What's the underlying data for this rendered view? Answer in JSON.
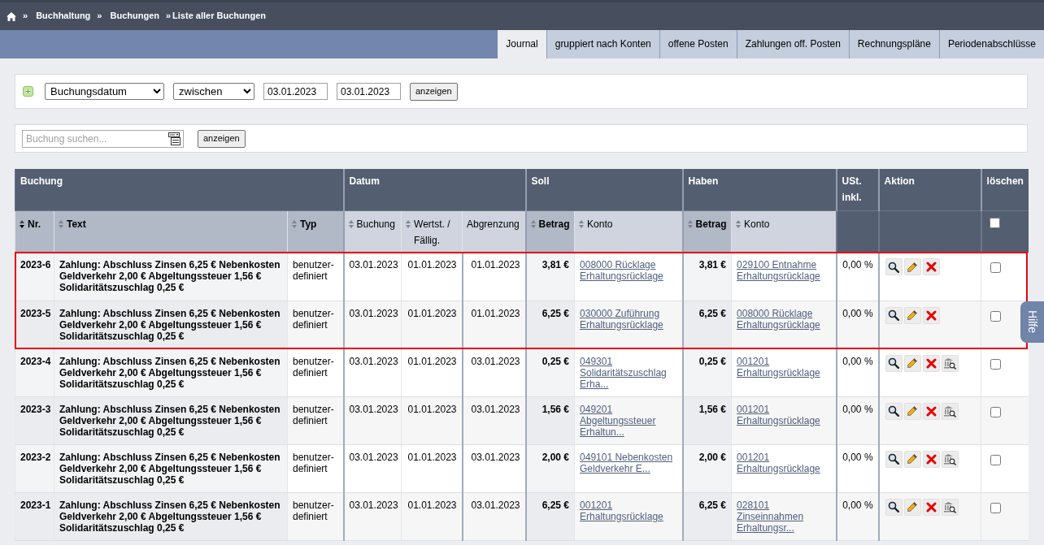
{
  "breadcrumb": {
    "items": [
      {
        "separator": "»",
        "label": "Buchhaltung"
      },
      {
        "separator": "»",
        "label": "Buchungen"
      },
      {
        "separator": "»",
        "label": "Liste aller Buchungen"
      }
    ]
  },
  "tabs": [
    {
      "label": "Journal",
      "selected": true
    },
    {
      "label": "gruppiert nach Konten",
      "selected": false
    },
    {
      "label": "offene Posten",
      "selected": false
    },
    {
      "label": "Zahlungen off. Posten",
      "selected": false
    },
    {
      "label": "Rechnungspläne",
      "selected": false
    },
    {
      "label": "Periodenabschlüsse",
      "selected": false
    }
  ],
  "filter": {
    "field": {
      "value": "Buchungsdatum"
    },
    "operator": {
      "value": "zwischen"
    },
    "from": {
      "value": "03.01.2023"
    },
    "to": {
      "value": "03.01.2023"
    },
    "button": "anzeigen"
  },
  "search": {
    "placeholder": "Buchung suchen...",
    "button": "anzeigen"
  },
  "table": {
    "groups": [
      {
        "label": "Buchung",
        "columns": [
          {
            "label": "Nr.",
            "kind": "key",
            "sortable": true,
            "sorted": true
          },
          {
            "label": "Text",
            "kind": "key",
            "sortable": true,
            "sorted": false
          },
          {
            "label": "Typ",
            "kind": "label",
            "sortable": true,
            "sorted": false
          }
        ]
      },
      {
        "label": "Datum",
        "columns": [
          {
            "label": "Buchung",
            "kind": "plain",
            "sortable": true,
            "sorted": false
          },
          {
            "label": "Wertst. / Fällig.",
            "kind": "plain",
            "sortable": true,
            "sorted": false
          },
          {
            "label": "Abgrenzung",
            "kind": "plain",
            "sortable": false
          }
        ]
      },
      {
        "label": "Soll",
        "columns": [
          {
            "label": "Betrag",
            "kind": "key",
            "sortable": true,
            "sorted": false
          },
          {
            "label": "Konto",
            "kind": "link",
            "sortable": true,
            "sorted": false
          }
        ]
      },
      {
        "label": "Haben",
        "columns": [
          {
            "label": "Betrag",
            "kind": "key",
            "sortable": true,
            "sorted": false
          },
          {
            "label": "Konto",
            "kind": "link",
            "sortable": true,
            "sorted": false
          }
        ]
      },
      {
        "label": "USt. inkl."
      },
      {
        "label": "Aktion"
      },
      {
        "label": "löschen",
        "select_all": {
          "checked": false
        }
      }
    ],
    "rows": [
      {
        "nr": "2023-6",
        "text": "Zahlung: Abschluss Zinsen 6,25 € Nebenkosten Geldverkehr 2,00 € Abgeltungssteuer 1,56 € Solidaritätszuschlag 0,25 €",
        "typ": "benutzer-definiert",
        "buchung": "03.01.2023",
        "wertstellung": "01.01.2023",
        "abgrenzung": "01.01.2023",
        "soll_betrag": "3,81 €",
        "soll_konto": "008000 Rücklage Erhaltungsrücklage",
        "haben_betrag": "3,81 €",
        "haben_konto": "029100 Entnahme Erhaltungsrücklage",
        "ust": "0,00 %",
        "actions": [
          {
            "kind": "view"
          },
          {
            "kind": "edit"
          },
          {
            "kind": "delete"
          }
        ],
        "checked": false,
        "highlighted": true
      },
      {
        "nr": "2023-5",
        "text": "Zahlung: Abschluss Zinsen 6,25 € Nebenkosten Geldverkehr 2,00 € Abgeltungssteuer 1,56 € Solidaritätszuschlag 0,25 €",
        "typ": "benutzer-definiert",
        "buchung": "03.01.2023",
        "wertstellung": "01.01.2023",
        "abgrenzung": "01.01.2023",
        "soll_betrag": "6,25 €",
        "soll_konto": "030000 Zuführung Erhaltungsrücklage",
        "haben_betrag": "6,25 €",
        "haben_konto": "008000 Rücklage Erhaltungsrücklage",
        "ust": "0,00 %",
        "actions": [
          {
            "kind": "view"
          },
          {
            "kind": "edit"
          },
          {
            "kind": "delete"
          }
        ],
        "checked": false,
        "highlighted": true
      },
      {
        "nr": "2023-4",
        "text": "Zahlung: Abschluss Zinsen 6,25 € Nebenkosten Geldverkehr 2,00 € Abgeltungssteuer 1,56 € Solidaritätszuschlag 0,25 €",
        "typ": "benutzer-definiert",
        "buchung": "03.01.2023",
        "wertstellung": "01.01.2023",
        "abgrenzung": "03.01.2023",
        "soll_betrag": "0,25 €",
        "soll_konto": "049301 Solidaritätszuschlag Erha...",
        "haben_betrag": "0,25 €",
        "haben_konto": "001201 Erhaltungsrücklage",
        "ust": "0,00 %",
        "actions": [
          {
            "kind": "view"
          },
          {
            "kind": "edit"
          },
          {
            "kind": "delete"
          },
          {
            "kind": "bank_search"
          }
        ],
        "checked": false,
        "highlighted": false
      },
      {
        "nr": "2023-3",
        "text": "Zahlung: Abschluss Zinsen 6,25 € Nebenkosten Geldverkehr 2,00 € Abgeltungssteuer 1,56 € Solidaritätszuschlag 0,25 €",
        "typ": "benutzer-definiert",
        "buchung": "03.01.2023",
        "wertstellung": "01.01.2023",
        "abgrenzung": "03.01.2023",
        "soll_betrag": "1,56 €",
        "soll_konto": "049201 Abgeltungssteuer Erhaltun...",
        "haben_betrag": "1,56 €",
        "haben_konto": "001201 Erhaltungsrücklage",
        "ust": "0,00 %",
        "actions": [
          {
            "kind": "view"
          },
          {
            "kind": "edit"
          },
          {
            "kind": "delete"
          },
          {
            "kind": "bank_search"
          }
        ],
        "checked": false,
        "highlighted": false
      },
      {
        "nr": "2023-2",
        "text": "Zahlung: Abschluss Zinsen 6,25 € Nebenkosten Geldverkehr 2,00 € Abgeltungssteuer 1,56 € Solidaritätszuschlag 0,25 €",
        "typ": "benutzer-definiert",
        "buchung": "03.01.2023",
        "wertstellung": "01.01.2023",
        "abgrenzung": "03.01.2023",
        "soll_betrag": "2,00 €",
        "soll_konto": "049101 Nebenkosten Geldverkehr E...",
        "haben_betrag": "2,00 €",
        "haben_konto": "001201 Erhaltungsrücklage",
        "ust": "0,00 %",
        "actions": [
          {
            "kind": "view"
          },
          {
            "kind": "edit"
          },
          {
            "kind": "delete"
          },
          {
            "kind": "bank_search"
          }
        ],
        "checked": false,
        "highlighted": false
      },
      {
        "nr": "2023-1",
        "text": "Zahlung: Abschluss Zinsen 6,25 € Nebenkosten Geldverkehr 2,00 € Abgeltungssteuer 1,56 € Solidaritätszuschlag 0,25 €",
        "typ": "benutzer-definiert",
        "buchung": "03.01.2023",
        "wertstellung": "01.01.2023",
        "abgrenzung": "03.01.2023",
        "soll_betrag": "6,25 €",
        "soll_konto": "001201 Erhaltungsrücklage",
        "haben_betrag": "6,25 €",
        "haben_konto": "028101 Zinseinnahmen Erhaltungsr...",
        "ust": "0,00 %",
        "actions": [
          {
            "kind": "view"
          },
          {
            "kind": "edit"
          },
          {
            "kind": "delete"
          },
          {
            "kind": "bank_search"
          }
        ],
        "checked": false,
        "highlighted": false
      }
    ]
  },
  "help_tab": {
    "label": "Hilfe"
  }
}
